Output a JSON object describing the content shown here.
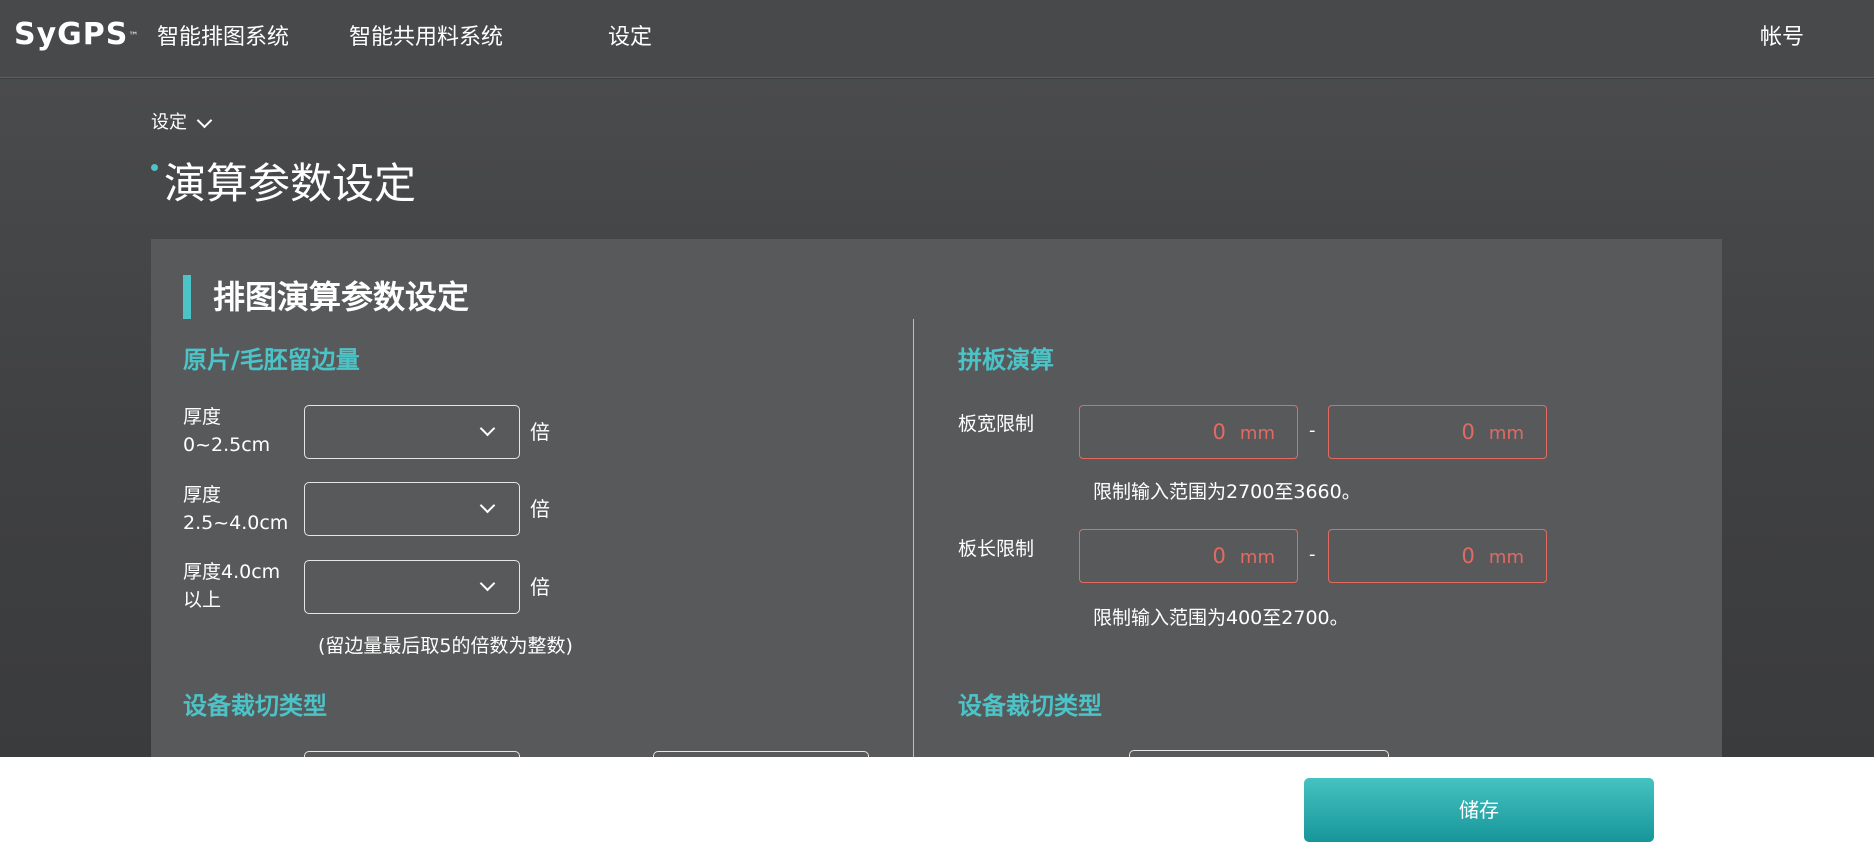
{
  "app": {
    "logo": "SyGPS",
    "logo_tm": "™"
  },
  "nav": {
    "items": [
      "智能排图系统",
      "智能共用料系统",
      "设定"
    ],
    "account": "帐号"
  },
  "breadcrumb": {
    "label": "设定"
  },
  "page": {
    "title": "演算参数设定"
  },
  "card": {
    "title": "排图演算参数设定",
    "left": {
      "section_margin": "原片/毛胚留边量",
      "rows": [
        {
          "label_line1": "厚度",
          "label_line2": "0~2.5cm",
          "unit": "倍",
          "value": ""
        },
        {
          "label_line1": "厚度",
          "label_line2": "2.5~4.0cm",
          "unit": "倍",
          "value": ""
        },
        {
          "label_line1": "厚度4.0cm",
          "label_line2": "以上",
          "unit": "倍",
          "value": ""
        }
      ],
      "margin_note": "(留边量最后取5的倍数为整数)",
      "section_cut": "设备裁切类型"
    },
    "right": {
      "section_panel": "拼板演算",
      "width_limit": {
        "label": "板宽限制",
        "min": "0",
        "max": "0",
        "unit": "mm",
        "separator": "-",
        "hint": "限制输入范围为2700至3660。"
      },
      "length_limit": {
        "label": "板长限制",
        "min": "0",
        "max": "0",
        "unit": "mm",
        "separator": "-",
        "hint": "限制输入范围为400至2700。"
      },
      "section_cut": "设备裁切类型"
    }
  },
  "footer": {
    "save_label": "储存"
  },
  "colors": {
    "accent": "#4cc3c7",
    "error": "#e36a63",
    "card_bg": "#58595b",
    "save_button": "#17969a"
  }
}
